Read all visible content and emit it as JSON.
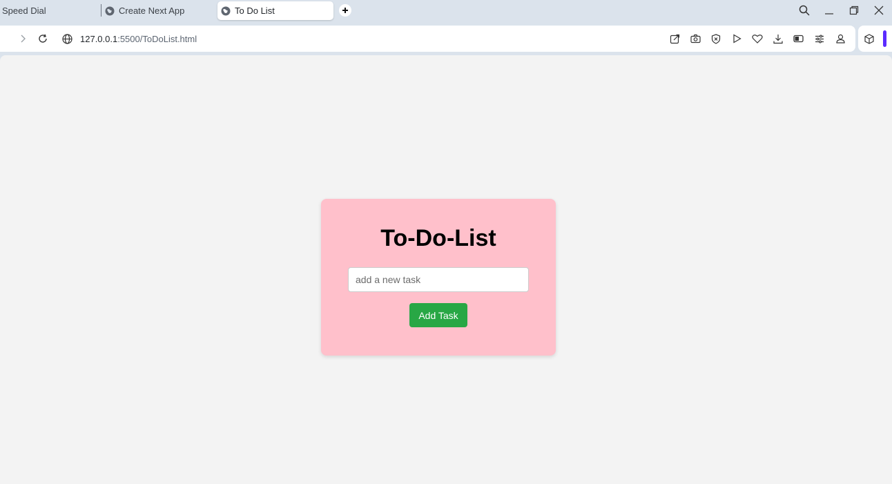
{
  "browser": {
    "tabs": [
      {
        "label": "Speed Dial"
      },
      {
        "label": "Create Next App"
      },
      {
        "label": "To Do List"
      }
    ],
    "address": {
      "host": "127.0.0.1",
      "path": ":5500/ToDoList.html"
    },
    "accent_color": "#5b2bff"
  },
  "page": {
    "title": "To-Do-List",
    "input": {
      "placeholder": "add a new task",
      "value": ""
    },
    "add_button_label": "Add Task",
    "card_color": "#ffc0cb",
    "button_color": "#28a745",
    "background_color": "#f3f3f3"
  }
}
